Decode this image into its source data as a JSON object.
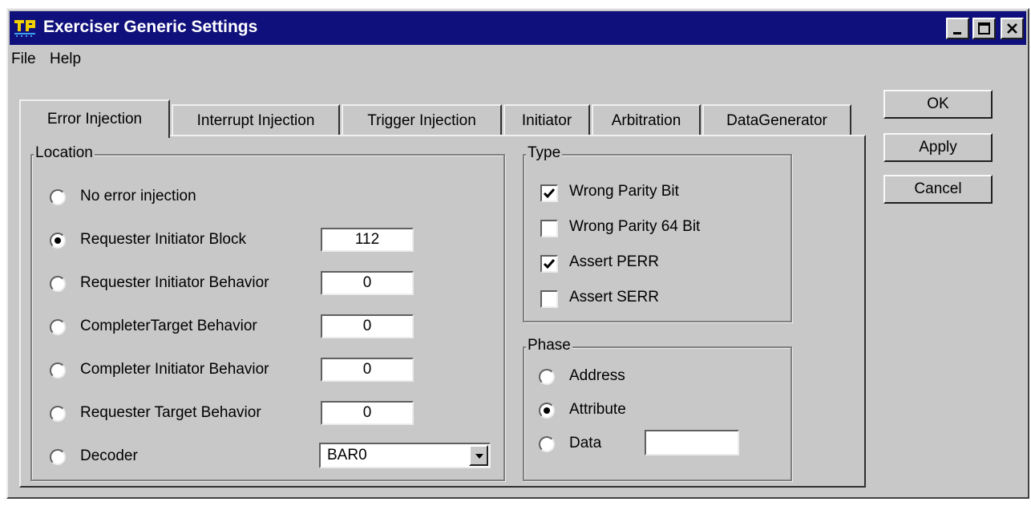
{
  "window": {
    "title": "Exerciser Generic Settings"
  },
  "menu": [
    {
      "label": "File"
    },
    {
      "label": "Help"
    }
  ],
  "tabs": [
    {
      "label": "Error Injection",
      "active": true
    },
    {
      "label": "Interrupt Injection",
      "active": false
    },
    {
      "label": "Trigger Injection",
      "active": false
    },
    {
      "label": "Initiator",
      "active": false
    },
    {
      "label": "Arbitration",
      "active": false
    },
    {
      "label": "DataGenerator",
      "active": false
    }
  ],
  "buttons": {
    "ok": "OK",
    "apply": "Apply",
    "cancel": "Cancel"
  },
  "location": {
    "label": "Location",
    "options": [
      {
        "label": "No error injection",
        "selected": false
      },
      {
        "label": "Requester Initiator Block",
        "selected": true,
        "value": "112"
      },
      {
        "label": "Requester Initiator Behavior",
        "selected": false,
        "value": "0"
      },
      {
        "label": "CompleterTarget Behavior",
        "selected": false,
        "value": "0"
      },
      {
        "label": "Completer Initiator Behavior",
        "selected": false,
        "value": "0"
      },
      {
        "label": "Requester Target Behavior",
        "selected": false,
        "value": "0"
      },
      {
        "label": "Decoder",
        "selected": false,
        "value": "BAR0"
      }
    ]
  },
  "type": {
    "label": "Type",
    "options": [
      {
        "label": "Wrong Parity Bit",
        "checked": true
      },
      {
        "label": "Wrong Parity 64 Bit",
        "checked": false
      },
      {
        "label": "Assert PERR",
        "checked": true
      },
      {
        "label": "Assert SERR",
        "checked": false
      }
    ]
  },
  "phase": {
    "label": "Phase",
    "options": [
      {
        "label": "Address",
        "selected": false
      },
      {
        "label": "Attribute",
        "selected": true
      },
      {
        "label": "Data",
        "selected": false,
        "value": ""
      }
    ]
  },
  "colors": {
    "titlebar": "#10107c",
    "face": "#c8c8c8"
  }
}
